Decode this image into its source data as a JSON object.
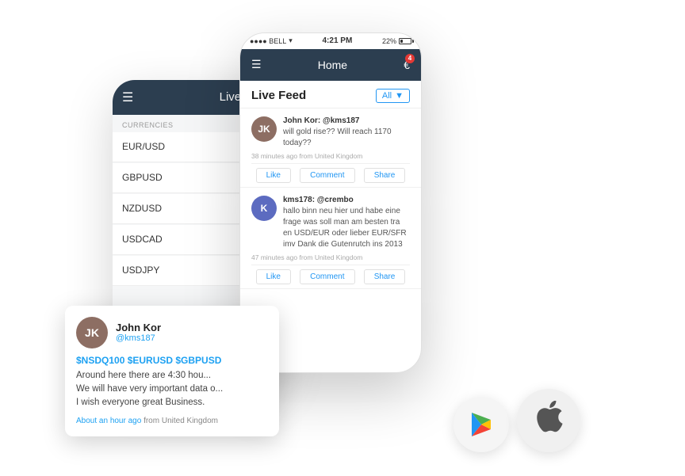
{
  "scene": {
    "background_color": "#ffffff"
  },
  "phone_back": {
    "header": {
      "title": "Live Rate"
    },
    "currencies_label": "CURRENCIES",
    "currency_rows": [
      {
        "name": "EUR/USD",
        "bar_color": "gray"
      },
      {
        "name": "GBPUSD",
        "bar_color": "green"
      },
      {
        "name": "NZDUSD",
        "bar_color": "gray"
      },
      {
        "name": "USDCAD",
        "bar_color": "red"
      },
      {
        "name": "USDJPY",
        "bar_color": "gray"
      }
    ]
  },
  "phone_front": {
    "status_bar": {
      "signal": "●●●● BELL",
      "wifi": "▾",
      "time": "4:21 PM",
      "battery_pct": "22%"
    },
    "nav": {
      "title": "Home",
      "euro_badge_count": "4"
    },
    "feed": {
      "label": "Live Feed",
      "filter_label": "All",
      "items": [
        {
          "username": "John Kor: @kms187",
          "message": "will gold rise?? Will reach 1170 today??",
          "time": "38 minutes ago from United Kingdom",
          "avatar_initials": "JK",
          "actions": [
            "Like",
            "Comment",
            "Share"
          ]
        },
        {
          "username": "kms178: @crembo",
          "message": "hallo binn neu hier und habe eine frage was soll man am besten tra en USD/EUR oder lieber EUR/SFR imv Dank die Gutenrutch ins 2013",
          "time": "47 minutes ago from United Kingdom",
          "avatar_initials": "K",
          "actions": [
            "Like",
            "Comment",
            "Share"
          ]
        }
      ]
    }
  },
  "tweet_card": {
    "avatar_initials": "JK",
    "username": "John Kor",
    "handle": "@kms187",
    "hashtags": "$NSDQ100 $EURUSD $GBPUSD",
    "body": "Around here there are 4:30 hou...\nWe will have very important data o...\nI wish everyone great Business.",
    "time": "About an hour ago",
    "from": "from United Kingdom"
  },
  "badges": {
    "google_play_label": "Google Play",
    "apple_label": "App Store"
  }
}
